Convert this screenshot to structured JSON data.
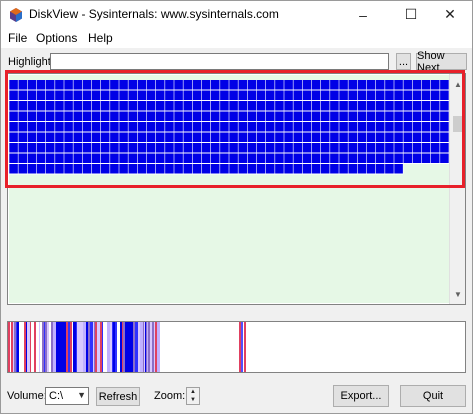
{
  "window": {
    "title": "DiskView - Sysinternals: www.sysinternals.com",
    "minimize": "–",
    "maximize": "☐",
    "close": "✕"
  },
  "menu": {
    "file": "File",
    "options": "Options",
    "help": "Help"
  },
  "highlight": {
    "label": "Highlight:",
    "value": "",
    "browse_label": "...",
    "show_next_label": "Show Next"
  },
  "cluster_map": {
    "block_color": "#0000e6",
    "free_color": "#e6f8e6",
    "selection_color": "#e8202a",
    "full_rows": 8,
    "last_row_fraction": 0.9
  },
  "footer": {
    "volume_label": "Volume:",
    "volume_value": "C:\\",
    "refresh_label": "Refresh",
    "zoom_label": "Zoom:",
    "export_label": "Export...",
    "quit_label": "Quit"
  }
}
